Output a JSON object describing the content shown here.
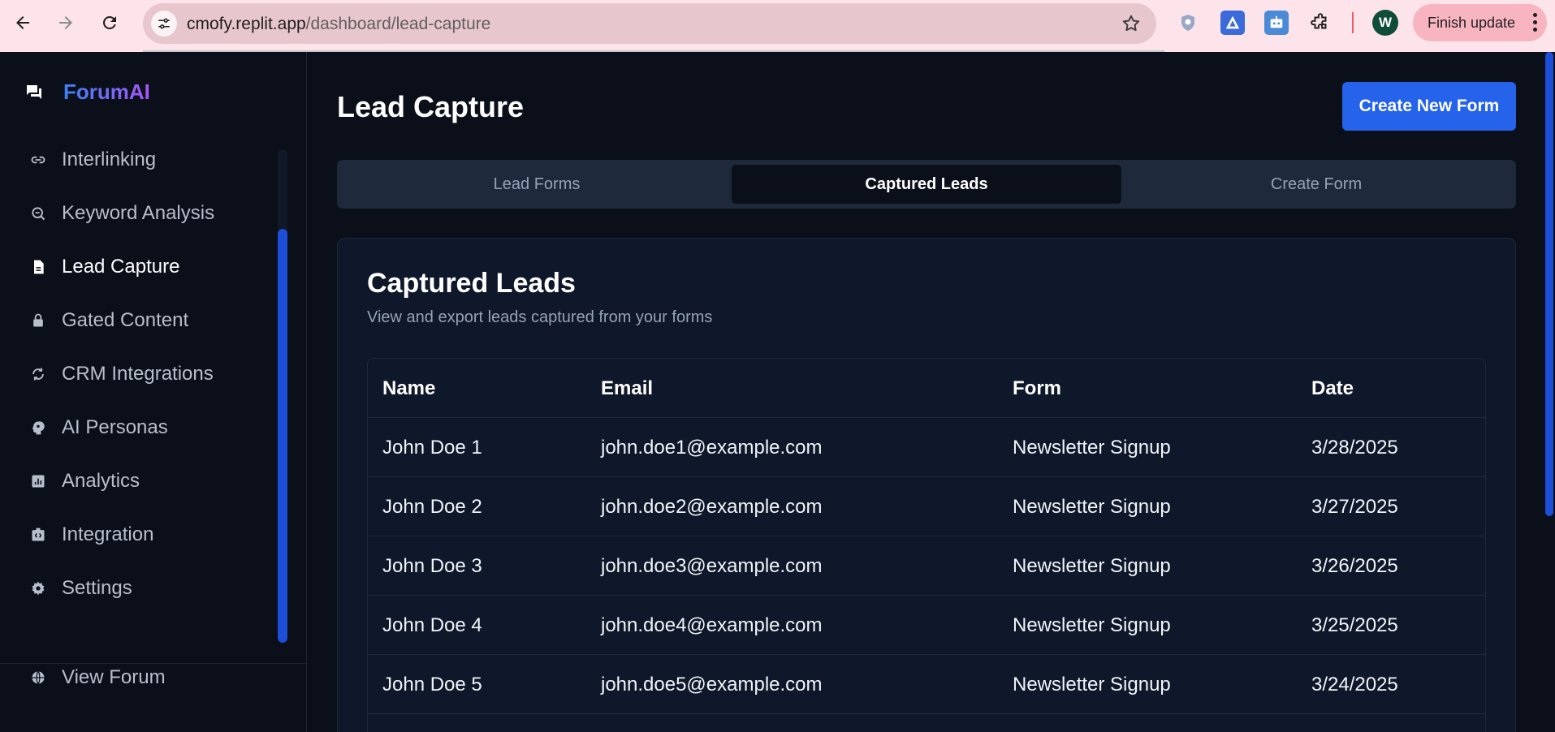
{
  "browser": {
    "url_host": "cmofy.replit.app",
    "url_path": "/dashboard/lead-capture",
    "profile_initial": "W",
    "update_button": "Finish update"
  },
  "sidebar": {
    "brand": "ForumAI",
    "items": [
      {
        "label": "Interlinking",
        "icon": "link-icon"
      },
      {
        "label": "Keyword Analysis",
        "icon": "keyword-search-icon"
      },
      {
        "label": "Lead Capture",
        "icon": "document-icon"
      },
      {
        "label": "Gated Content",
        "icon": "lock-icon"
      },
      {
        "label": "CRM Integrations",
        "icon": "sync-icon"
      },
      {
        "label": "AI Personas",
        "icon": "psychology-icon"
      },
      {
        "label": "Analytics",
        "icon": "analytics-icon"
      },
      {
        "label": "Integration",
        "icon": "integration-icon"
      },
      {
        "label": "Settings",
        "icon": "gear-icon"
      }
    ],
    "footer_item": {
      "label": "View Forum",
      "icon": "globe-icon"
    },
    "accent": "#1d4ed8"
  },
  "main": {
    "title": "Lead Capture",
    "create_button": "Create New Form",
    "tabs": [
      "Lead Forms",
      "Captured Leads",
      "Create Form"
    ],
    "active_tab": "Captured Leads",
    "card": {
      "title": "Captured Leads",
      "description": "View and export leads captured from your forms"
    },
    "table": {
      "columns": [
        "Name",
        "Email",
        "Form",
        "Date"
      ],
      "rows": [
        [
          "John Doe 1",
          "john.doe1@example.com",
          "Newsletter Signup",
          "3/28/2025"
        ],
        [
          "John Doe 2",
          "john.doe2@example.com",
          "Newsletter Signup",
          "3/27/2025"
        ],
        [
          "John Doe 3",
          "john.doe3@example.com",
          "Newsletter Signup",
          "3/26/2025"
        ],
        [
          "John Doe 4",
          "john.doe4@example.com",
          "Newsletter Signup",
          "3/25/2025"
        ],
        [
          "John Doe 5",
          "john.doe5@example.com",
          "Newsletter Signup",
          "3/24/2025"
        ]
      ]
    },
    "primary_color": "#2563eb"
  }
}
